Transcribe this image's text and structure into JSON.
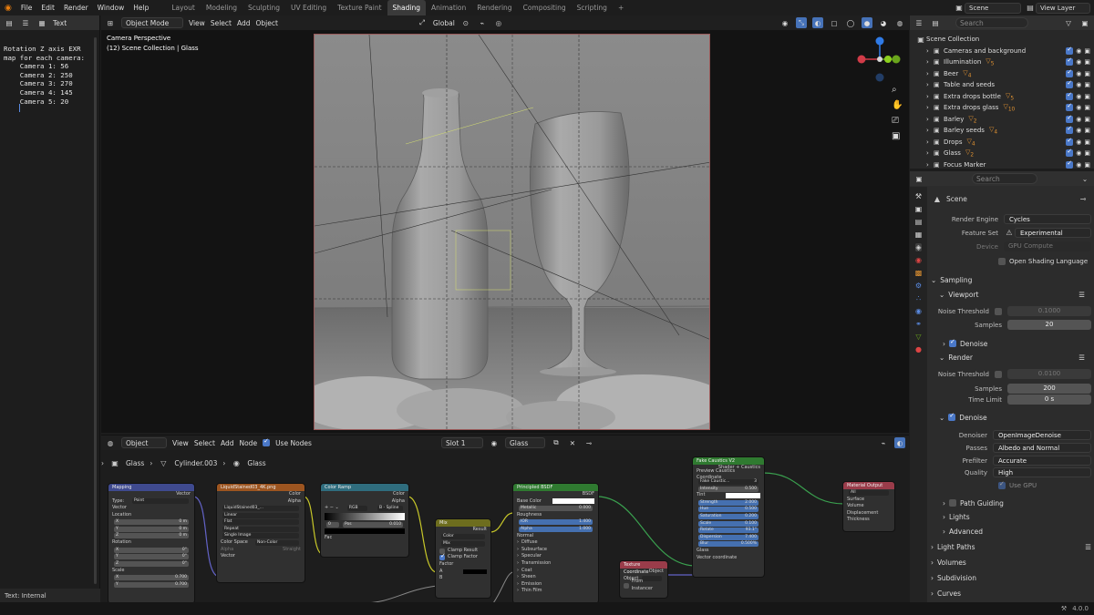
{
  "menu": {
    "items": [
      "File",
      "Edit",
      "Render",
      "Window",
      "Help"
    ]
  },
  "workspaces": {
    "tabs": [
      "Layout",
      "Modeling",
      "Sculpting",
      "UV Editing",
      "Texture Paint",
      "Shading",
      "Animation",
      "Rendering",
      "Compositing",
      "Scripting"
    ],
    "active": "Shading"
  },
  "scene": {
    "name": "Scene",
    "view_layer": "View Layer"
  },
  "text_editor": {
    "header_label": "Text",
    "content": "Rotation Z axis EXR\nmap for each camera:\n    Camera 1: 56\n    Camera 2: 250\n    Camera 3: 270\n    Camera 4: 145\n    Camera 5: 20",
    "footer": "Text: Internal"
  },
  "viewport": {
    "mode": "Object Mode",
    "menus": [
      "View",
      "Select",
      "Add",
      "Object"
    ],
    "orientation": "Global",
    "overlay_line1": "Camera Perspective",
    "overlay_line2": "(12) Scene Collection | Glass"
  },
  "outliner": {
    "search_placeholder": "Search",
    "root": "Scene Collection",
    "items": [
      {
        "label": "Cameras and background",
        "badge": ""
      },
      {
        "label": "Illumination",
        "badge": "5"
      },
      {
        "label": "Beer",
        "badge": "4"
      },
      {
        "label": "Table and seeds",
        "badge": ""
      },
      {
        "label": "Extra drops bottle",
        "badge": "5"
      },
      {
        "label": "Extra drops glass",
        "badge": "10"
      },
      {
        "label": "Barley",
        "badge": "2"
      },
      {
        "label": "Barley seeds",
        "badge": "4"
      },
      {
        "label": "Drops",
        "badge": "4"
      },
      {
        "label": "Glass",
        "badge": "2"
      },
      {
        "label": "Focus Marker",
        "badge": ""
      }
    ]
  },
  "properties": {
    "search_placeholder": "Search",
    "context": "Scene",
    "render_engine_label": "Render Engine",
    "render_engine": "Cycles",
    "feature_set_label": "Feature Set",
    "feature_set": "Experimental",
    "device_label": "Device",
    "device": "GPU Compute",
    "osl_label": "Open Shading Language",
    "sampling": "Sampling",
    "viewport": "Viewport",
    "noise_threshold_label": "Noise Threshold",
    "viewport_noise": "0.1000",
    "samples_label": "Samples",
    "viewport_samples": "20",
    "denoise_label": "Denoise",
    "render": "Render",
    "render_noise": "0.0100",
    "render_samples": "200",
    "time_limit_label": "Time Limit",
    "time_limit": "0 s",
    "denoiser_label": "Denoiser",
    "denoiser": "OpenImageDenoise",
    "passes_label": "Passes",
    "passes": "Albedo and Normal",
    "prefilter_label": "Prefilter",
    "prefilter": "Accurate",
    "quality_label": "Quality",
    "quality": "High",
    "use_gpu_label": "Use GPU",
    "sections": [
      "Path Guiding",
      "Lights",
      "Advanced",
      "Light Paths",
      "Volumes",
      "Subdivision",
      "Curves"
    ]
  },
  "node_editor": {
    "type": "Object",
    "menus": [
      "View",
      "Select",
      "Add",
      "Node"
    ],
    "use_nodes": "Use Nodes",
    "slot": "Slot 1",
    "material": "Glass",
    "breadcrumbs": [
      "Glass",
      "Cylinder.003",
      "Glass"
    ],
    "nodes": {
      "mapping": {
        "title": "Mapping",
        "out": "Vector",
        "type_label": "Type:",
        "type": "Point",
        "rows": [
          "Vector",
          "Location",
          "Rotation",
          "Scale"
        ],
        "loc": [
          "0 m",
          "0 m",
          "0 m"
        ],
        "rot": [
          "0°",
          "0°",
          "0°"
        ],
        "scale": [
          "0.700",
          "0.700"
        ]
      },
      "image": {
        "title": "LiquidStained03_4K.png",
        "outs": [
          "Color",
          "Alpha"
        ],
        "file": "LiquidStained03_...",
        "opts": [
          "Linear",
          "Flat",
          "Repeat",
          "Single Image"
        ],
        "cs_label": "Color Space",
        "cs": "Non-Color",
        "alpha_label": "Alpha",
        "alpha": "Straight",
        "in": "Vector"
      },
      "ramp": {
        "title": "Color Ramp",
        "outs": [
          "Color",
          "Alpha"
        ],
        "mode": "RGB",
        "interp": "B - Spline",
        "idx": "0",
        "pos_label": "Pos",
        "pos": "0.010",
        "in": "Fac"
      },
      "mix": {
        "title": "Mix",
        "out": "Result",
        "type": "Color",
        "blend": "Mix",
        "clamp_result": "Clamp Result",
        "clamp_factor": "Clamp Factor",
        "ins": [
          "Factor",
          "A",
          "B"
        ]
      },
      "bsdf": {
        "title": "Principled BSDF",
        "out": "BSDF",
        "rows": [
          "Base Color",
          "Metallic",
          "Roughness",
          "IOR",
          "Alpha",
          "Normal"
        ],
        "metallic": "0.000",
        "ior": "1.400",
        "alpha": "1.000",
        "subs": [
          "Diffuse",
          "Subsurface",
          "Specular",
          "Transmission",
          "Coat",
          "Sheen",
          "Emission",
          "Thin Film"
        ]
      },
      "caustics": {
        "title": "Fake Caustics V2",
        "outs": [
          "Shader + Caustics",
          "Preview Caustics Coordinate"
        ],
        "sub": "Fake Caustic...",
        "sub_users": "3",
        "rows": [
          [
            "Intensity",
            "0.500"
          ],
          [
            "Tint",
            ""
          ],
          [
            "Strength",
            "2.000"
          ],
          [
            "Hue",
            "0.500"
          ],
          [
            "Saturation",
            "0.200"
          ],
          [
            "Scale",
            "0.100"
          ],
          [
            "Rotate",
            "93.1°"
          ],
          [
            "Dispersion",
            "7.400"
          ],
          [
            "Blur",
            "0.500%"
          ]
        ],
        "ins": [
          "Glass",
          "Vector coordinate"
        ]
      },
      "texcoord": {
        "title": "Texture Coordinate",
        "out": "Object",
        "object_label": "Object",
        "from_instancer": "From Instancer"
      },
      "output": {
        "title": "Material Output",
        "target": "All",
        "ins": [
          "Surface",
          "Volume",
          "Displacement",
          "Thickness"
        ]
      }
    }
  },
  "status": {
    "version": "4.0.0"
  }
}
